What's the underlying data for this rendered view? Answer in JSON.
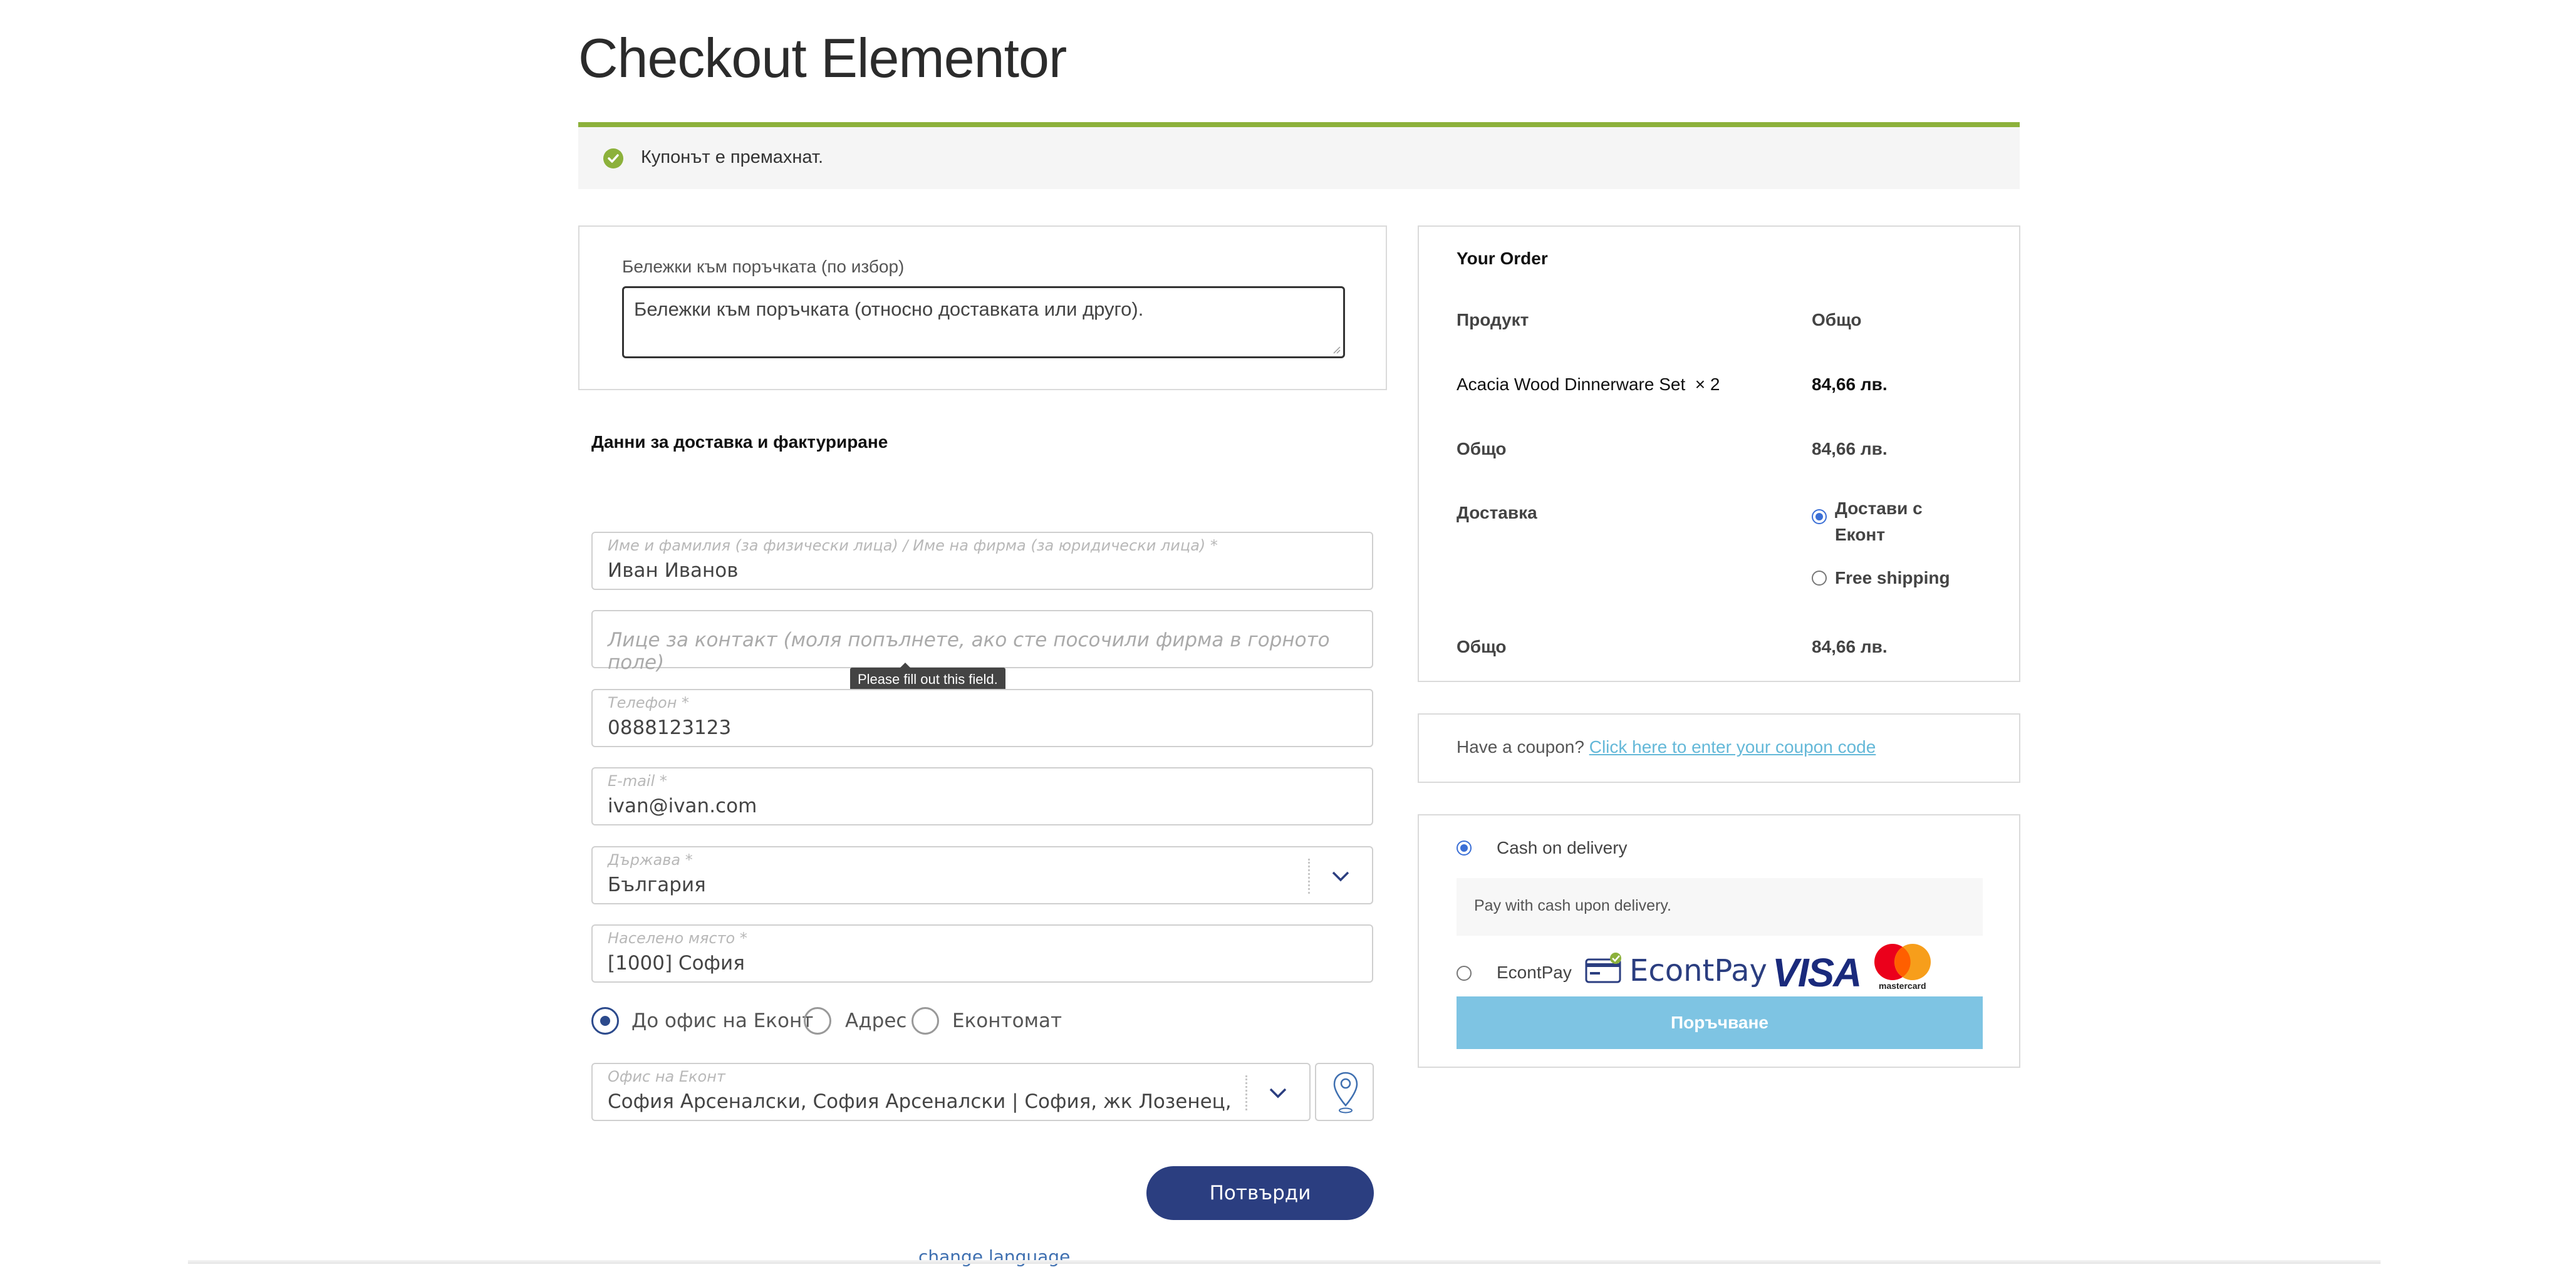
{
  "page": {
    "title": "Checkout Elementor"
  },
  "notice": {
    "message": "Купонът е премахнат."
  },
  "notes": {
    "label": "Бележки към поръчката (по избор)",
    "placeholder": "Бележки към поръчката (относно доставката или друго)."
  },
  "shipping": {
    "heading": "Данни за доставка и фактуриране",
    "fields": {
      "name": {
        "label": "Име и фамилия (за физически лица) / Име на фирма (за юридически лица) *",
        "value": "Иван Иванов"
      },
      "contact": {
        "placeholder": "Лице за контакт (моля попълнете, ако сте посочили фирма в горното поле)"
      },
      "phone": {
        "label": "Телефон *",
        "value": "0888123123"
      },
      "email": {
        "label": "E-mail *",
        "value": "ivan@ivan.com"
      },
      "country": {
        "label": "Държава *",
        "value": "България"
      },
      "city": {
        "label": "Населено място *",
        "value": "[1000] София"
      },
      "office": {
        "label": "Офис на Еконт",
        "value": "София Арсеналски, София Арсеналски | София, жк Лозенец, ул. Д..."
      }
    },
    "tooltip": "Please fill out this field.",
    "delivery_options": [
      {
        "label": "До офис на Еконт",
        "selected": true
      },
      {
        "label": "Адрес",
        "selected": false
      },
      {
        "label": "Еконтомат",
        "selected": false
      }
    ],
    "confirm_label": "Потвърди",
    "change_language": "change language"
  },
  "order": {
    "title": "Your Order",
    "col_product": "Продукт",
    "col_total": "Общо",
    "item_name": "Acacia Wood Dinnerware Set",
    "item_qty": "× 2",
    "item_price": "84,66 лв.",
    "subtotal_label": "Общо",
    "subtotal_value": "84,66 лв.",
    "shipping_label": "Доставка",
    "shipping_options": [
      {
        "label": "Достави с Еконт",
        "selected": true
      },
      {
        "label": "Free shipping",
        "selected": false
      }
    ],
    "total_label": "Общо",
    "total_value": "84,66 лв."
  },
  "coupon": {
    "prompt": "Have a coupon?",
    "link": "Click here to enter your coupon code"
  },
  "payment": {
    "methods": [
      {
        "label": "Cash on delivery",
        "selected": true,
        "description": "Pay with cash upon delivery."
      },
      {
        "label": "EcontPay",
        "selected": false,
        "logo_text": "EcontPay",
        "cards": [
          "VISA",
          "mastercard"
        ]
      }
    ],
    "place_order_label": "Поръчване"
  },
  "colors": {
    "accent_green": "#8cb13b",
    "confirm_blue": "#2b3e80",
    "order_button": "#7ec4e3",
    "link": "#64b8d8"
  }
}
